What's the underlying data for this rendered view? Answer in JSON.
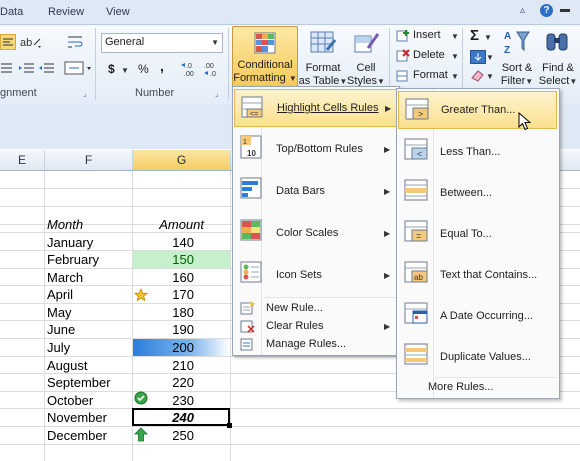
{
  "tabs": [
    "Data",
    "Review",
    "View"
  ],
  "ribbon": {
    "alignment_label": "gnment",
    "number_label": "Number",
    "number_format": "General",
    "currency_symbol": "$",
    "percent_symbol": "%",
    "comma_symbol": ",",
    "increase_decimal": "←.0\n.00",
    "decrease_decimal": ".00\n→.0",
    "conditional_formatting_line1": "Conditional",
    "conditional_formatting_line2": "Formatting",
    "format_table_line1": "Format",
    "format_table_line2": "as Table",
    "cell_styles_line1": "Cell",
    "cell_styles_line2": "Styles",
    "insert_label": "Insert",
    "delete_label": "Delete",
    "format_label": "Format",
    "sort_line1": "Sort &",
    "sort_line2": "Filter",
    "find_line1": "Find &",
    "find_line2": "Select",
    "sigma": "Σ"
  },
  "columns": [
    "E",
    "F",
    "G"
  ],
  "table": {
    "header_month": "Month",
    "header_amount": "Amount",
    "rows": [
      {
        "month": "January",
        "amount": "140"
      },
      {
        "month": "February",
        "amount": "150"
      },
      {
        "month": "March",
        "amount": "160"
      },
      {
        "month": "April",
        "amount": "170"
      },
      {
        "month": "May",
        "amount": "180"
      },
      {
        "month": "June",
        "amount": "190"
      },
      {
        "month": "July",
        "amount": "200"
      },
      {
        "month": "August",
        "amount": "210"
      },
      {
        "month": "September",
        "amount": "220"
      },
      {
        "month": "October",
        "amount": "230"
      },
      {
        "month": "November",
        "amount": "240"
      },
      {
        "month": "December",
        "amount": "250"
      }
    ]
  },
  "cf_menu": {
    "items": [
      "Highlight Cells Rules",
      "Top/Bottom Rules",
      "Data Bars",
      "Color Scales",
      "Icon Sets"
    ],
    "new_rule": "New Rule...",
    "clear_rules": "Clear Rules",
    "manage_rules": "Manage Rules..."
  },
  "sub_menu": {
    "items": [
      "Greater Than...",
      "Less Than...",
      "Between...",
      "Equal To...",
      "Text that Contains...",
      "A Date Occurring...",
      "Duplicate Values..."
    ],
    "more_rules": "More Rules..."
  },
  "colors": {
    "highlight": "#fde9a6",
    "green_fill": "#c6efce",
    "green_text": "#006100",
    "blue_bar": "#2a7fdb"
  }
}
